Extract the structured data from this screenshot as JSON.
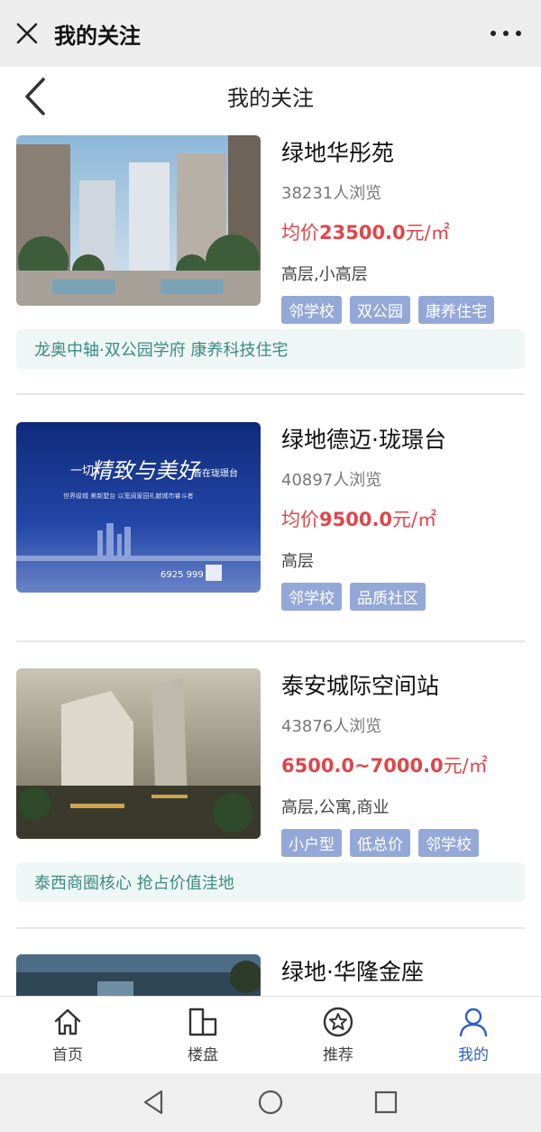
{
  "header": {
    "title": "我的关注",
    "close_icon": "close-icon",
    "more_icon": "more-icon"
  },
  "nav": {
    "title": "我的关注",
    "back_icon": "chevron-left-icon"
  },
  "items": [
    {
      "name": "绿地华彤苑",
      "views": "38231人浏览",
      "price_prefix": "均价",
      "price_value": "23500.0",
      "price_unit": "元/㎡",
      "types": "高层,小高层",
      "tags": [
        "邻学校",
        "双公园",
        "康养住宅"
      ],
      "slogan": "龙奥中轴·双公园学府 康养科技住宅"
    },
    {
      "name": "绿地德迈·珑璟台",
      "views": "40897人浏览",
      "price_prefix": "均价",
      "price_value": "9500.0",
      "price_unit": "元/㎡",
      "types": "高层",
      "tags": [
        "邻学校",
        "品质社区"
      ],
      "ad": {
        "line1": "一切",
        "line2": "精致与美好",
        "line3": "皆在珑璟台",
        "sub": "世界级城 美新墅台 以宽阔家园礼献城市睿斗者",
        "phone": "6925 999"
      }
    },
    {
      "name": "泰安城际空间站",
      "views": "43876人浏览",
      "price_prefix": "",
      "price_value": "6500.0~7000.0",
      "price_unit": "元/㎡",
      "types": "高层,公寓,商业",
      "tags": [
        "小户型",
        "低总价",
        "邻学校"
      ],
      "slogan": "泰西商圈核心 抢占价值洼地"
    },
    {
      "name": "绿地·华隆金座"
    }
  ],
  "tabs": [
    {
      "label": "首页",
      "icon": "home-icon",
      "active": false
    },
    {
      "label": "楼盘",
      "icon": "building-icon",
      "active": false
    },
    {
      "label": "推荐",
      "icon": "star-icon",
      "active": false
    },
    {
      "label": "我的",
      "icon": "user-icon",
      "active": true
    }
  ],
  "colors": {
    "accent": "#2f5ec4",
    "price": "#e0454a",
    "tag": "#94a8d8",
    "slogan_bg": "#eef7f5",
    "slogan_text": "#3d8a84"
  }
}
